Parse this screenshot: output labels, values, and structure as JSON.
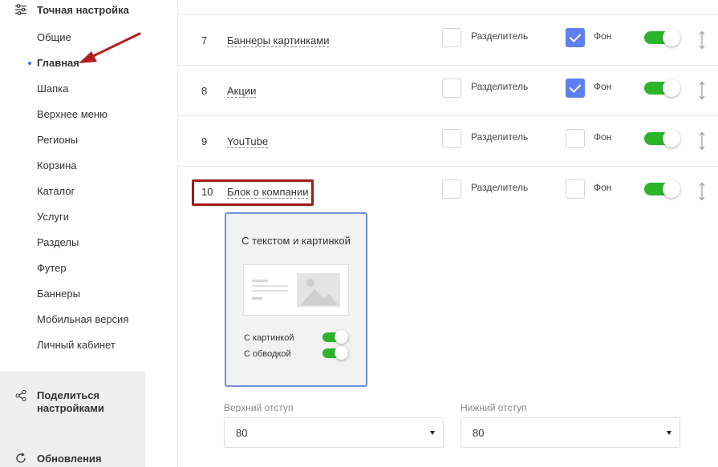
{
  "sidebar": {
    "header": {
      "label": "Точная настройка",
      "icon": "sliders-icon"
    },
    "items": [
      {
        "label": "Общие",
        "active": false
      },
      {
        "label": "Главная",
        "active": true
      },
      {
        "label": "Шапка",
        "active": false
      },
      {
        "label": "Верхнее меню",
        "active": false
      },
      {
        "label": "Регионы",
        "active": false
      },
      {
        "label": "Корзина",
        "active": false
      },
      {
        "label": "Каталог",
        "active": false
      },
      {
        "label": "Услуги",
        "active": false
      },
      {
        "label": "Разделы",
        "active": false
      },
      {
        "label": "Футер",
        "active": false
      },
      {
        "label": "Баннеры",
        "active": false
      },
      {
        "label": "Мобильная версия",
        "active": false
      },
      {
        "label": "Личный кабинет",
        "active": false
      }
    ],
    "share": {
      "label": "Поделиться настройками",
      "icon": "share-icon"
    },
    "updates": {
      "label": "Обновления",
      "icon": "refresh-icon"
    }
  },
  "rows": [
    {
      "num": "7",
      "title": "Баннеры картинками",
      "separator_label": "Разделитель",
      "separator_checked": false,
      "bg_label": "Фон",
      "bg_checked": true,
      "enabled": true
    },
    {
      "num": "8",
      "title": "Акции",
      "separator_label": "Разделитель",
      "separator_checked": false,
      "bg_label": "Фон",
      "bg_checked": true,
      "enabled": true
    },
    {
      "num": "9",
      "title": "YouTube",
      "separator_label": "Разделитель",
      "separator_checked": false,
      "bg_label": "Фон",
      "bg_checked": false,
      "enabled": true
    },
    {
      "num": "10",
      "title": "Блок о компании",
      "separator_label": "Разделитель",
      "separator_checked": false,
      "bg_label": "Фон",
      "bg_checked": false,
      "enabled": true
    }
  ],
  "card": {
    "title": "С текстом и картинкой",
    "options": [
      {
        "label": "С картинкой",
        "enabled": true
      },
      {
        "label": "С обводкой",
        "enabled": true
      }
    ]
  },
  "padding": {
    "top": {
      "label": "Верхний отступ",
      "value": "80"
    },
    "bottom": {
      "label": "Нижний отступ",
      "value": "80"
    }
  },
  "colors": {
    "accent": "#5d7ff0",
    "toggle_on": "#2bb52b",
    "highlight": "#a01818",
    "arrow": "#b31d1d"
  }
}
